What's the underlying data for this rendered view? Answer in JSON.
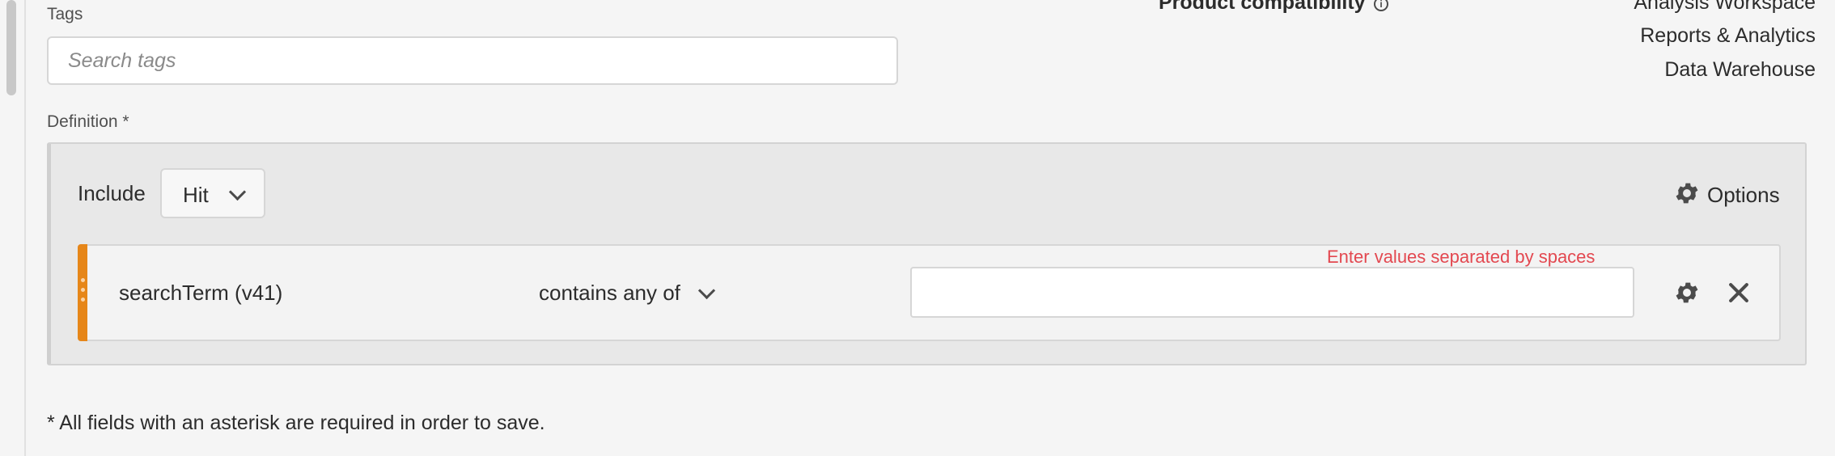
{
  "tags": {
    "label": "Tags",
    "placeholder": "Search tags"
  },
  "product_compatibility": {
    "label": "Product compatibility",
    "items": [
      "Analysis Workspace",
      "Reports & Analytics",
      "Data Warehouse"
    ]
  },
  "definition": {
    "label": "Definition *",
    "include_label": "Include",
    "scope_value": "Hit",
    "options_label": "Options",
    "rule": {
      "field": "searchTerm (v41)",
      "operator": "contains any of",
      "hint": "Enter values separated by spaces",
      "value": ""
    }
  },
  "footnote": "* All fields with an asterisk are required in order to save.",
  "icons": {
    "info": "info-icon",
    "gear": "gear-icon",
    "close": "close-icon",
    "chevron": "chevron-down-icon",
    "drag": "drag-handle-icon"
  },
  "colors": {
    "accent_orange": "#e68619",
    "hint_red": "#e34850"
  }
}
